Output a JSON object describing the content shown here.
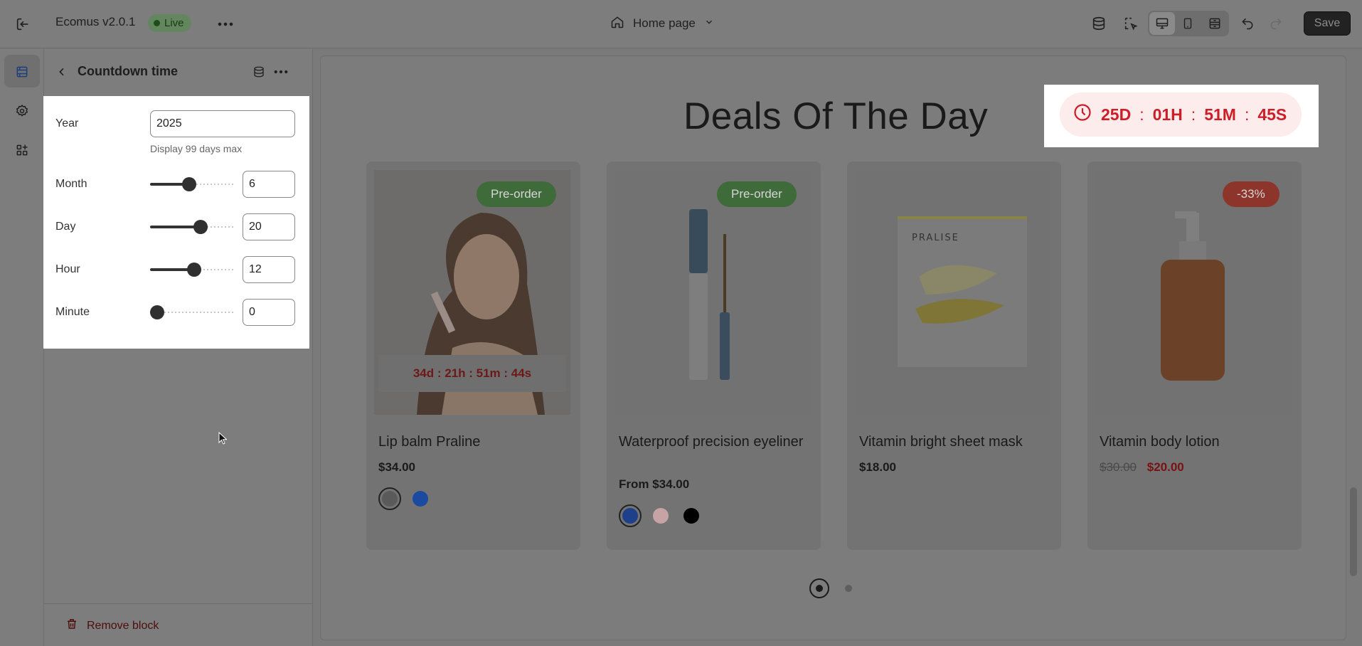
{
  "topbar": {
    "app_title": "Ecomus v2.0.1",
    "live_label": "Live",
    "page_select": "Home page",
    "save_label": "Save"
  },
  "panel": {
    "title": "Countdown time",
    "year_label": "Year",
    "year_value": "2025",
    "helper": "Display 99 days max",
    "fields": [
      {
        "label": "Month",
        "value": "6",
        "fraction": 0.45
      },
      {
        "label": "Day",
        "value": "20",
        "fraction": 0.61
      },
      {
        "label": "Hour",
        "value": "12",
        "fraction": 0.52
      },
      {
        "label": "Minute",
        "value": "0",
        "fraction": 0.0
      }
    ],
    "remove_label": "Remove block"
  },
  "preview": {
    "title": "Deals Of The Day",
    "timer": {
      "days": "25D",
      "hours": "01H",
      "minutes": "51M",
      "seconds": "45S",
      "sep": ":"
    },
    "products": [
      {
        "name": "Lip balm Praline",
        "price": "$34.00",
        "badge": "Pre-order",
        "timer": "34d : 21h : 51m : 44s"
      },
      {
        "name": "Waterproof precision eyeliner",
        "price": "From $34.00",
        "badge": "Pre-order"
      },
      {
        "name": "Vitamin bright sheet mask",
        "price": "$18.00"
      },
      {
        "name": "Vitamin body lotion",
        "old_price": "$30.00",
        "new_price": "$20.00",
        "badge": "-33%"
      }
    ],
    "swatch_colors": [
      "#5a5a5a",
      "#1b4aa0",
      "#1e3f8a",
      "#c7a3a6",
      "#000000"
    ]
  }
}
